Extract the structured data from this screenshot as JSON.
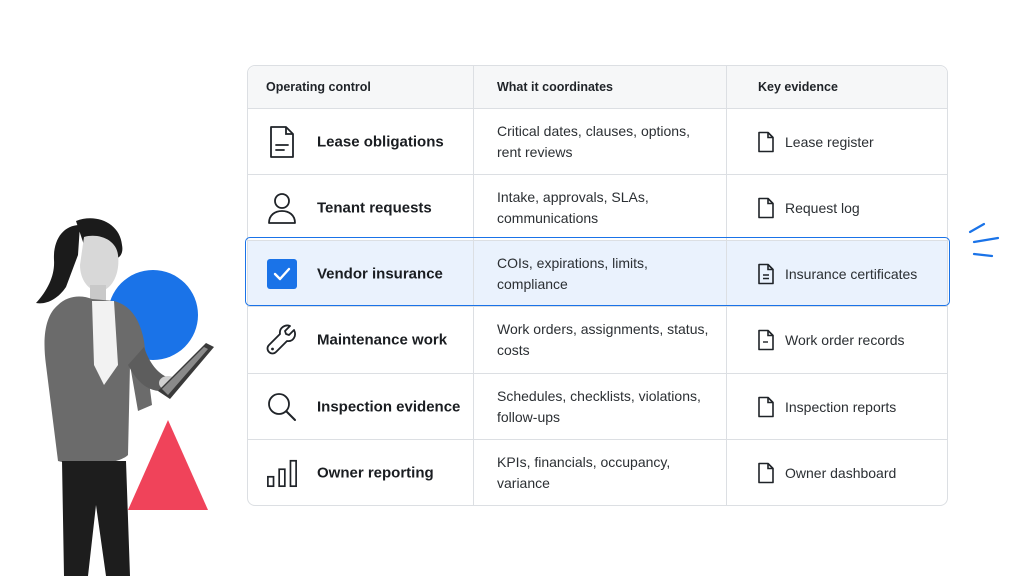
{
  "table": {
    "headers": [
      "Operating control",
      "What it coordinates",
      "Key evidence"
    ],
    "rows": [
      {
        "icon": "document-icon",
        "control": "Lease obligations",
        "coordinates": "Critical dates, clauses, options, rent reviews",
        "evidence_icon": "file-icon",
        "evidence": "Lease register"
      },
      {
        "icon": "person-icon",
        "control": "Tenant requests",
        "coordinates": "Intake, approvals, SLAs, communications",
        "evidence_icon": "file-icon",
        "evidence": "Request log"
      },
      {
        "icon": "checkbox-icon",
        "control": "Vendor insurance",
        "coordinates": "COIs, expirations, limits, compliance",
        "evidence_icon": "file-lines-icon",
        "evidence": "Insurance certificates",
        "highlighted": true
      },
      {
        "icon": "wrench-icon",
        "control": "Maintenance work",
        "coordinates": "Work orders, assignments, status, costs",
        "evidence_icon": "file-dash-icon",
        "evidence": "Work order records"
      },
      {
        "icon": "magnifier-icon",
        "control": "Inspection evidence",
        "coordinates": "Schedules, checklists, violations, follow-ups",
        "evidence_icon": "file-icon",
        "evidence": "Inspection reports"
      },
      {
        "icon": "bar-chart-icon",
        "control": "Owner reporting",
        "coordinates": "KPIs, financials, occupancy, variance",
        "evidence_icon": "file-icon",
        "evidence": "Owner dashboard"
      }
    ]
  },
  "colors": {
    "accent": "#1a73e8",
    "highlight_bg": "#eaf2fd",
    "triangle": "#f0435a",
    "border": "#dcdfe3"
  }
}
